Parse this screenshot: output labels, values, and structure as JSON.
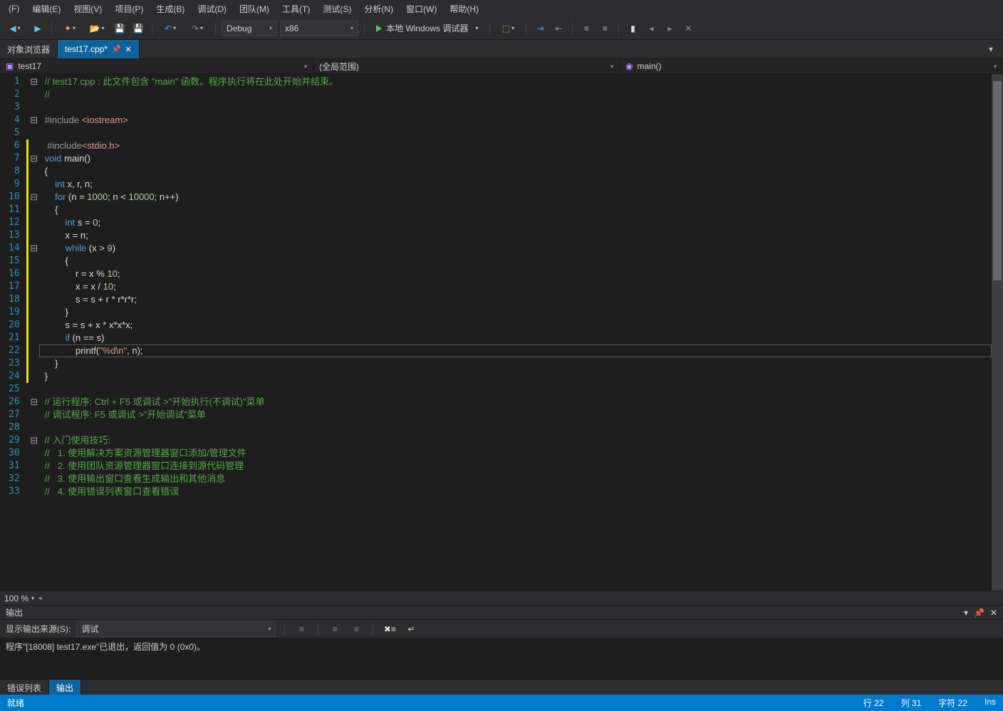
{
  "menu": [
    "(F)",
    "编辑(E)",
    "视图(V)",
    "项目(P)",
    "生成(B)",
    "调试(D)",
    "团队(M)",
    "工具(T)",
    "测试(S)",
    "分析(N)",
    "窗口(W)",
    "帮助(H)"
  ],
  "toolbar": {
    "config": "Debug",
    "platform": "x86",
    "run_label": "本地 Windows 调试器"
  },
  "tabs": {
    "inactive": "对象浏览器",
    "active": "test17.cpp*"
  },
  "nav": {
    "project": "test17",
    "scope": "(全局范围)",
    "func": "main()"
  },
  "code_lines": [
    {
      "n": 1,
      "fold": "⊟",
      "chg": false,
      "html": "<span class='cm'>// test17.cpp : 此文件包含 \"main\" 函数。程序执行将在此处开始并结束。</span>"
    },
    {
      "n": 2,
      "fold": "",
      "chg": false,
      "html": "<span class='cm'>//</span>"
    },
    {
      "n": 3,
      "fold": "",
      "chg": false,
      "html": ""
    },
    {
      "n": 4,
      "fold": "⊟",
      "chg": false,
      "html": "<span class='pp'>#include</span> <span class='ppinc'>&lt;iostream&gt;</span>"
    },
    {
      "n": 5,
      "fold": "",
      "chg": false,
      "html": ""
    },
    {
      "n": 6,
      "fold": "",
      "chg": true,
      "html": " <span class='pp'>#include</span><span class='ppinc'>&lt;stdio.h&gt;</span>"
    },
    {
      "n": 7,
      "fold": "⊟",
      "chg": true,
      "html": "<span class='kw'>void</span> main()"
    },
    {
      "n": 8,
      "fold": "",
      "chg": true,
      "html": "{"
    },
    {
      "n": 9,
      "fold": "",
      "chg": true,
      "html": "    <span class='kw'>int</span> x, r, n;"
    },
    {
      "n": 10,
      "fold": "⊟",
      "chg": true,
      "html": "    <span class='kw'>for</span> (n = <span class='num'>1000</span>; n &lt; <span class='num'>10000</span>; n++)"
    },
    {
      "n": 11,
      "fold": "",
      "chg": true,
      "html": "    {"
    },
    {
      "n": 12,
      "fold": "",
      "chg": true,
      "html": "        <span class='kw'>int</span> s = <span class='num'>0</span>;"
    },
    {
      "n": 13,
      "fold": "",
      "chg": true,
      "html": "        x = n;"
    },
    {
      "n": 14,
      "fold": "⊟",
      "chg": true,
      "html": "        <span class='kw'>while</span> (x &gt; <span class='num'>9</span>)"
    },
    {
      "n": 15,
      "fold": "",
      "chg": true,
      "html": "        {"
    },
    {
      "n": 16,
      "fold": "",
      "chg": true,
      "html": "            r = x % <span class='num'>10</span>;"
    },
    {
      "n": 17,
      "fold": "",
      "chg": true,
      "html": "            x = x / <span class='num'>10</span>;"
    },
    {
      "n": 18,
      "fold": "",
      "chg": true,
      "html": "            s = s + r * r*r*r;"
    },
    {
      "n": 19,
      "fold": "",
      "chg": true,
      "html": "        }"
    },
    {
      "n": 20,
      "fold": "",
      "chg": true,
      "html": "        s = s + x * x*x*x;"
    },
    {
      "n": 21,
      "fold": "",
      "chg": true,
      "html": "        <span class='kw'>if</span> (n == s)"
    },
    {
      "n": 22,
      "fold": "",
      "chg": true,
      "html": "            printf(<span class='str'>\"%d\\n\"</span>, n);"
    },
    {
      "n": 23,
      "fold": "",
      "chg": true,
      "html": "    }"
    },
    {
      "n": 24,
      "fold": "",
      "chg": true,
      "html": "}"
    },
    {
      "n": 25,
      "fold": "",
      "chg": false,
      "html": ""
    },
    {
      "n": 26,
      "fold": "⊟",
      "chg": false,
      "html": "<span class='cm'>// 运行程序: Ctrl + F5 或调试 &gt;\"开始执行(不调试)\"菜单</span>"
    },
    {
      "n": 27,
      "fold": "",
      "chg": false,
      "html": "<span class='cm'>// 调试程序: F5 或调试 &gt;\"开始调试\"菜单</span>"
    },
    {
      "n": 28,
      "fold": "",
      "chg": false,
      "html": ""
    },
    {
      "n": 29,
      "fold": "⊟",
      "chg": false,
      "html": "<span class='cm'>// 入门使用技巧:</span>"
    },
    {
      "n": 30,
      "fold": "",
      "chg": false,
      "html": "<span class='cm'>//   1. 使用解决方案资源管理器窗口添加/管理文件</span>"
    },
    {
      "n": 31,
      "fold": "",
      "chg": false,
      "html": "<span class='cm'>//   2. 使用团队资源管理器窗口连接到源代码管理</span>"
    },
    {
      "n": 32,
      "fold": "",
      "chg": false,
      "html": "<span class='cm'>//   3. 使用输出窗口查看生成输出和其他消息</span>"
    },
    {
      "n": 33,
      "fold": "",
      "chg": false,
      "html": "<span class='cm'>//   4. 使用错误列表窗口查看错误</span>"
    }
  ],
  "current_line_index": 21,
  "zoom": "100 %",
  "output": {
    "title": "输出",
    "source_label": "显示输出来源(S):",
    "source_value": "调试",
    "text": "程序\"[18008] test17.exe\"已退出，返回值为 0 (0x0)。"
  },
  "bottom_tabs": {
    "inactive": "错误列表",
    "active": "输出"
  },
  "status": {
    "left": "就绪",
    "line": "行 22",
    "col": "列 31",
    "char": "字符 22",
    "ins": "Ins"
  }
}
